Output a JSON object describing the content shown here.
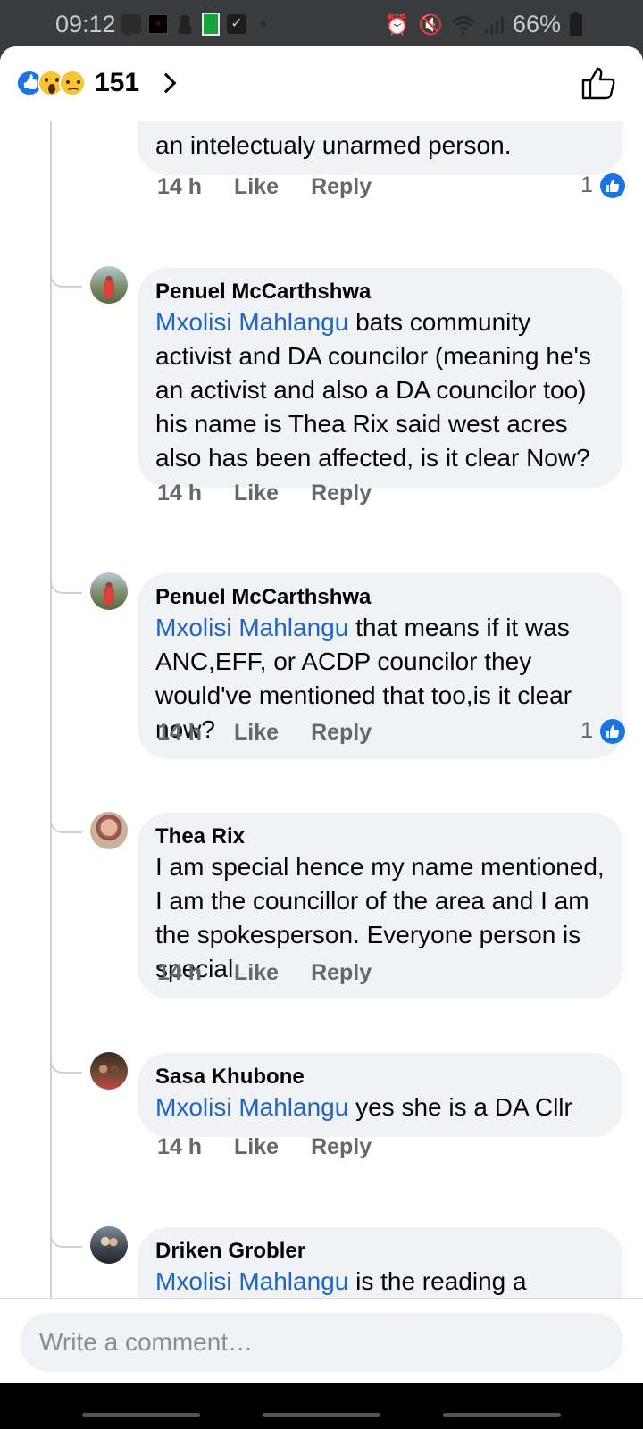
{
  "status_bar": {
    "time": "09:12",
    "battery": "66%",
    "icons": [
      "message-icon",
      "netflix-icon",
      "person-icon",
      "green-app-icon",
      "check-icon",
      "alarm-icon",
      "mute-icon",
      "wifi-icon",
      "signal-icon",
      "battery-icon"
    ]
  },
  "header": {
    "reaction_icons": [
      "like-reaction-icon",
      "wow-reaction-icon",
      "sad-reaction-icon"
    ],
    "reaction_count": "151"
  },
  "comments": [
    {
      "text": "an intelectualy unarmed person.",
      "time": "14 h",
      "like": "Like",
      "reply": "Reply",
      "likes": "1"
    },
    {
      "author": "Penuel McCarthshwa",
      "mention": "Mxolisi Mahlangu",
      "text": " bats community activist and DA councilor (meaning he's an activist and also a DA councilor too) his name is Thea Rix said west acres also has been affected, is it clear Now?",
      "time": "14 h",
      "like": "Like",
      "reply": "Reply"
    },
    {
      "author": "Penuel McCarthshwa",
      "mention": "Mxolisi Mahlangu",
      "text": " that means if it was ANC,EFF, or ACDP councilor they would've mentioned that too,is it clear now?",
      "time": "14 h",
      "like": "Like",
      "reply": "Reply",
      "likes": "1"
    },
    {
      "author": "Thea Rix",
      "text": "I am special hence my name mentioned,  I am the councillor of the area and I am the spokesperson. Everyone person is special.",
      "time": "14 h",
      "like": "Like",
      "reply": "Reply"
    },
    {
      "author": "Sasa Khubone",
      "mention": "Mxolisi Mahlangu",
      "text": " yes she is a DA Cllr",
      "time": "14 h",
      "like": "Like",
      "reply": "Reply"
    },
    {
      "author": "Driken Grobler",
      "mention": "Mxolisi Mahlangu",
      "text": " is the reading a problem or the understanding?"
    }
  ],
  "composer": {
    "placeholder": "Write a comment…"
  },
  "colors": {
    "brand_blue": "#1b74e4",
    "mention_blue": "#1d66c2",
    "bubble": "#f0f2f5",
    "meta_gray": "#65676b"
  }
}
